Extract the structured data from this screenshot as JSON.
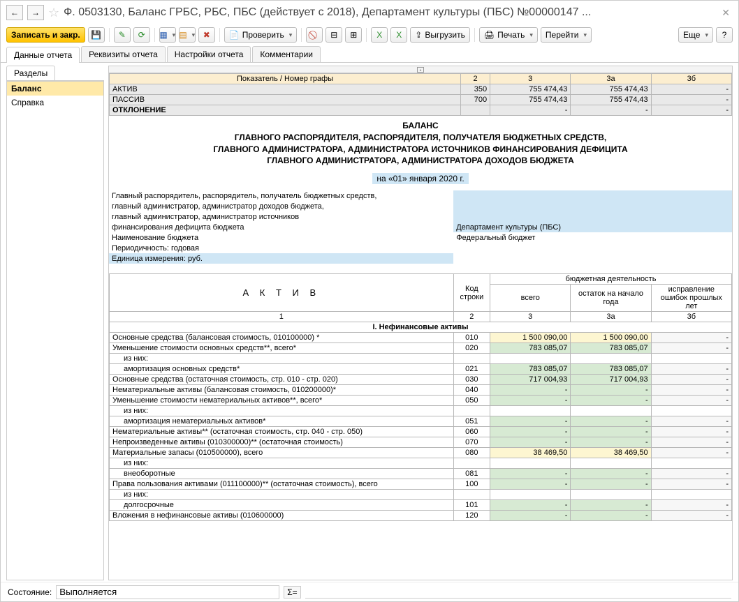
{
  "title": "Ф. 0503130, Баланс ГРБС, РБС, ПБС (действует с 2018), Департамент культуры (ПБС) №00000147 ...",
  "toolbar": {
    "record_close": "Записать и закр.",
    "check": "Проверить",
    "export": "Выгрузить",
    "print": "Печать",
    "goto": "Перейти",
    "more": "Еще"
  },
  "tabs": [
    "Данные отчета",
    "Реквизиты отчета",
    "Настройки отчета",
    "Комментарии"
  ],
  "sections_tab": "Разделы",
  "section_items": [
    "Баланс",
    "Справка"
  ],
  "summary_header": [
    "Показатель / Номер графы",
    "2",
    "3",
    "3а",
    "3б"
  ],
  "summary_rows": [
    {
      "label": "АКТИВ",
      "c2": "350",
      "c3": "755 474,43",
      "c3a": "755 474,43",
      "c3b": "-"
    },
    {
      "label": "ПАССИВ",
      "c2": "700",
      "c3": "755 474,43",
      "c3a": "755 474,43",
      "c3b": "-"
    },
    {
      "label": "ОТКЛОНЕНИЕ",
      "c2": "",
      "c3": "-",
      "c3a": "-",
      "c3b": "-"
    }
  ],
  "doc_title": [
    "БАЛАНС",
    "ГЛАВНОГО РАСПОРЯДИТЕЛЯ, РАСПОРЯДИТЕЛЯ, ПОЛУЧАТЕЛЯ БЮДЖЕТНЫХ СРЕДСТВ,",
    "ГЛАВНОГО АДМИНИСТРАТОРА, АДМИНИСТРАТОРА ИСТОЧНИКОВ ФИНАНСИРОВАНИЯ ДЕФИЦИТА",
    "ГЛАВНОГО АДМИНИСТРАТОРА, АДМИНИСТРАТОРА ДОХОДОВ БЮДЖЕТА"
  ],
  "date_label": "на «01» января 2020 г.",
  "meta": {
    "l1": "Главный распорядитель, распорядитель, получатель бюджетных средств,",
    "l2": "главный администратор, администратор доходов бюджета,",
    "l3": "главный администратор, администратор источников",
    "l4": "финансирования дефицита бюджета",
    "l5": "Наименование бюджета",
    "l6": "Периодичность: годовая",
    "l7": "Единица измерения: руб.",
    "v4": "Департамент культуры (ПБС)",
    "v5": "Федеральный бюджет"
  },
  "grid_header": {
    "aktiv": "А К Т И В",
    "code": "Код строки",
    "activity": "бюджетная деятельность",
    "total": "всего",
    "start": "остаток на начало года",
    "errors": "исправление ошибок прошлых лет",
    "n1": "1",
    "n2": "2",
    "n3": "3",
    "n3a": "3а",
    "n3b": "3б"
  },
  "section1": "I. Нефинансовые активы",
  "rows": [
    {
      "name": "Основные средства (балансовая стоимость, 010100000) *",
      "code": "010",
      "c3": "1 500 090,00",
      "c3a": "1 500 090,00",
      "c3b": "-",
      "g": "y"
    },
    {
      "name": "Уменьшение стоимости основных средств**, всего*",
      "code": "020",
      "c3": "783 085,07",
      "c3a": "783 085,07",
      "c3b": "-",
      "g": "g"
    },
    {
      "name": "из них:",
      "code": "",
      "sub": true
    },
    {
      "name": "амортизация основных средств*",
      "code": "021",
      "c3": "783 085,07",
      "c3a": "783 085,07",
      "c3b": "-",
      "g": "g",
      "sub": true
    },
    {
      "name": "Основные средства (остаточная стоимость, стр. 010 - стр. 020)",
      "code": "030",
      "c3": "717 004,93",
      "c3a": "717 004,93",
      "c3b": "-",
      "g": "g"
    },
    {
      "name": "Нематериальные активы (балансовая стоимость, 010200000)*",
      "code": "040",
      "c3": "-",
      "c3a": "-",
      "c3b": "-",
      "g": "g"
    },
    {
      "name": "Уменьшение стоимости нематериальных активов**, всего*",
      "code": "050",
      "c3": "-",
      "c3a": "-",
      "c3b": "-",
      "g": "g"
    },
    {
      "name": "из них:",
      "code": "",
      "sub": true
    },
    {
      "name": "амортизация нематериальных активов*",
      "code": "051",
      "c3": "-",
      "c3a": "-",
      "c3b": "-",
      "g": "g",
      "sub": true
    },
    {
      "name": "Нематериальные активы** (остаточная стоимость, стр. 040 - стр. 050)",
      "code": "060",
      "c3": "-",
      "c3a": "-",
      "c3b": "-",
      "g": "g"
    },
    {
      "name": "Непроизведенные активы (010300000)** (остаточная стоимость)",
      "code": "070",
      "c3": "-",
      "c3a": "-",
      "c3b": "-",
      "g": "g"
    },
    {
      "name": "Материальные запасы (010500000), всего",
      "code": "080",
      "c3": "38 469,50",
      "c3a": "38 469,50",
      "c3b": "-",
      "g": "y"
    },
    {
      "name": "из них:",
      "code": "",
      "sub": true
    },
    {
      "name": "внеоборотные",
      "code": "081",
      "c3": "-",
      "c3a": "-",
      "c3b": "-",
      "g": "g",
      "sub": true
    },
    {
      "name": "Права пользования активами (011100000)** (остаточная стоимость), всего",
      "code": "100",
      "c3": "-",
      "c3a": "-",
      "c3b": "-",
      "g": "g"
    },
    {
      "name": "из них:",
      "code": "",
      "sub": true
    },
    {
      "name": "долгосрочные",
      "code": "101",
      "c3": "-",
      "c3a": "-",
      "c3b": "-",
      "g": "g",
      "sub": true
    },
    {
      "name": "Вложения в нефинансовые активы (010600000)",
      "code": "120",
      "c3": "-",
      "c3a": "-",
      "c3b": "-",
      "g": "g"
    }
  ],
  "status": {
    "label": "Состояние:",
    "value": "Выполняется",
    "sum": "Σ="
  }
}
